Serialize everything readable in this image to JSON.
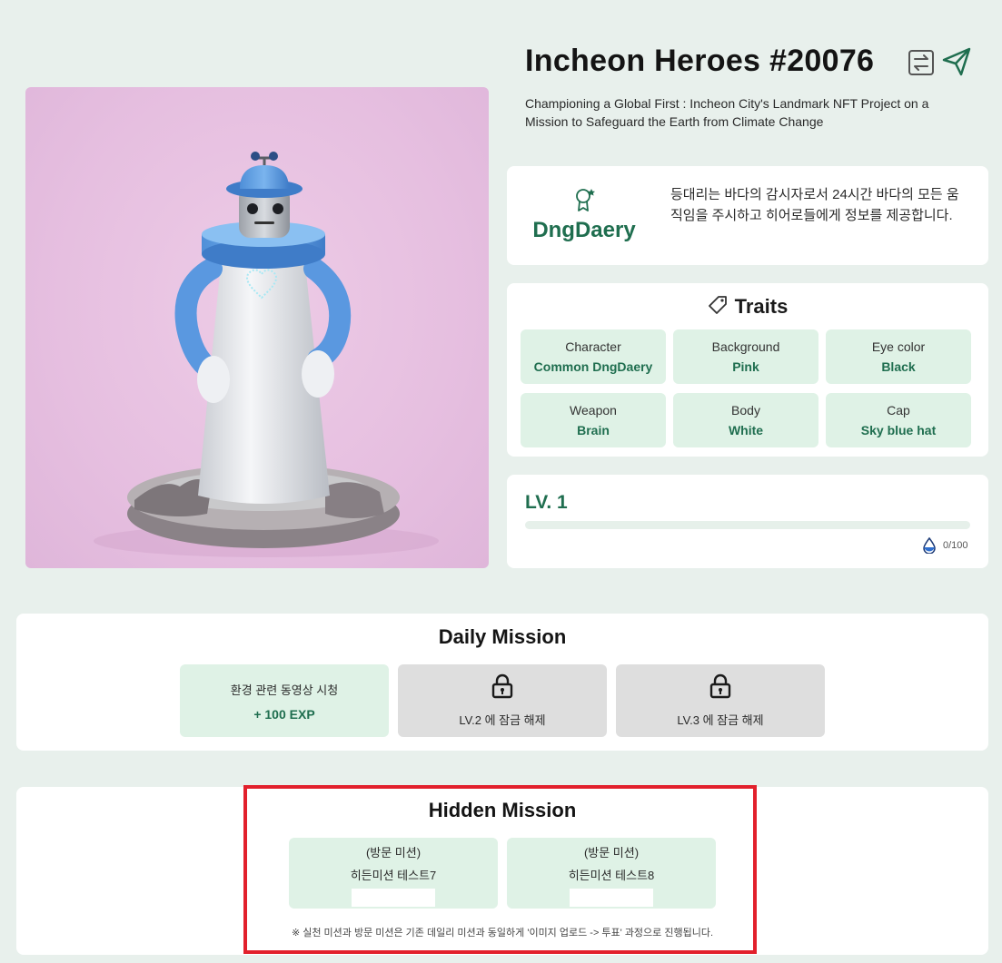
{
  "header": {
    "title": "Incheon Heroes #20076",
    "subtitle": "Championing a Global First : Incheon City's Landmark NFT Project on a Mission to Safeguard the Earth from Climate Change",
    "icons": [
      "transfer-icon",
      "send-icon"
    ]
  },
  "character": {
    "name": "DngDaery",
    "description": "등대리는 바다의 감시자로서 24시간 바다의 모든 움직임을 주시하고 히어로들에게 정보를 제공합니다."
  },
  "traits": {
    "title": "Traits",
    "items": [
      {
        "key": "Character",
        "value": "Common DngDaery"
      },
      {
        "key": "Background",
        "value": "Pink"
      },
      {
        "key": "Eye color",
        "value": "Black"
      },
      {
        "key": "Weapon",
        "value": "Brain"
      },
      {
        "key": "Body",
        "value": "White"
      },
      {
        "key": "Cap",
        "value": "Sky blue hat"
      }
    ]
  },
  "level": {
    "label": "LV. 1",
    "progress": 0,
    "count": "0/100"
  },
  "daily_mission": {
    "title": "Daily Mission",
    "missions": [
      {
        "label": "환경 관련 동영상 시청",
        "reward": "+ 100 EXP"
      },
      {
        "label": "LV.2 에 잠금 해제"
      },
      {
        "label": "LV.3 에 잠금 해제"
      }
    ]
  },
  "hidden_mission": {
    "title": "Hidden Mission",
    "missions": [
      {
        "type": "(방문 미션)",
        "name": "히든미션 테스트7"
      },
      {
        "type": "(방문 미션)",
        "name": "히든미션 테스트8"
      }
    ],
    "notice": "※ 실천 미션과 방문 미션은 기존 데일리 미션과 동일하게 '이미지 업로드 -> 투표' 과정으로 진행됩니다."
  },
  "colors": {
    "background": "#e8f0ec",
    "accent": "#1f6e4f",
    "highlight": "#e2202c"
  }
}
